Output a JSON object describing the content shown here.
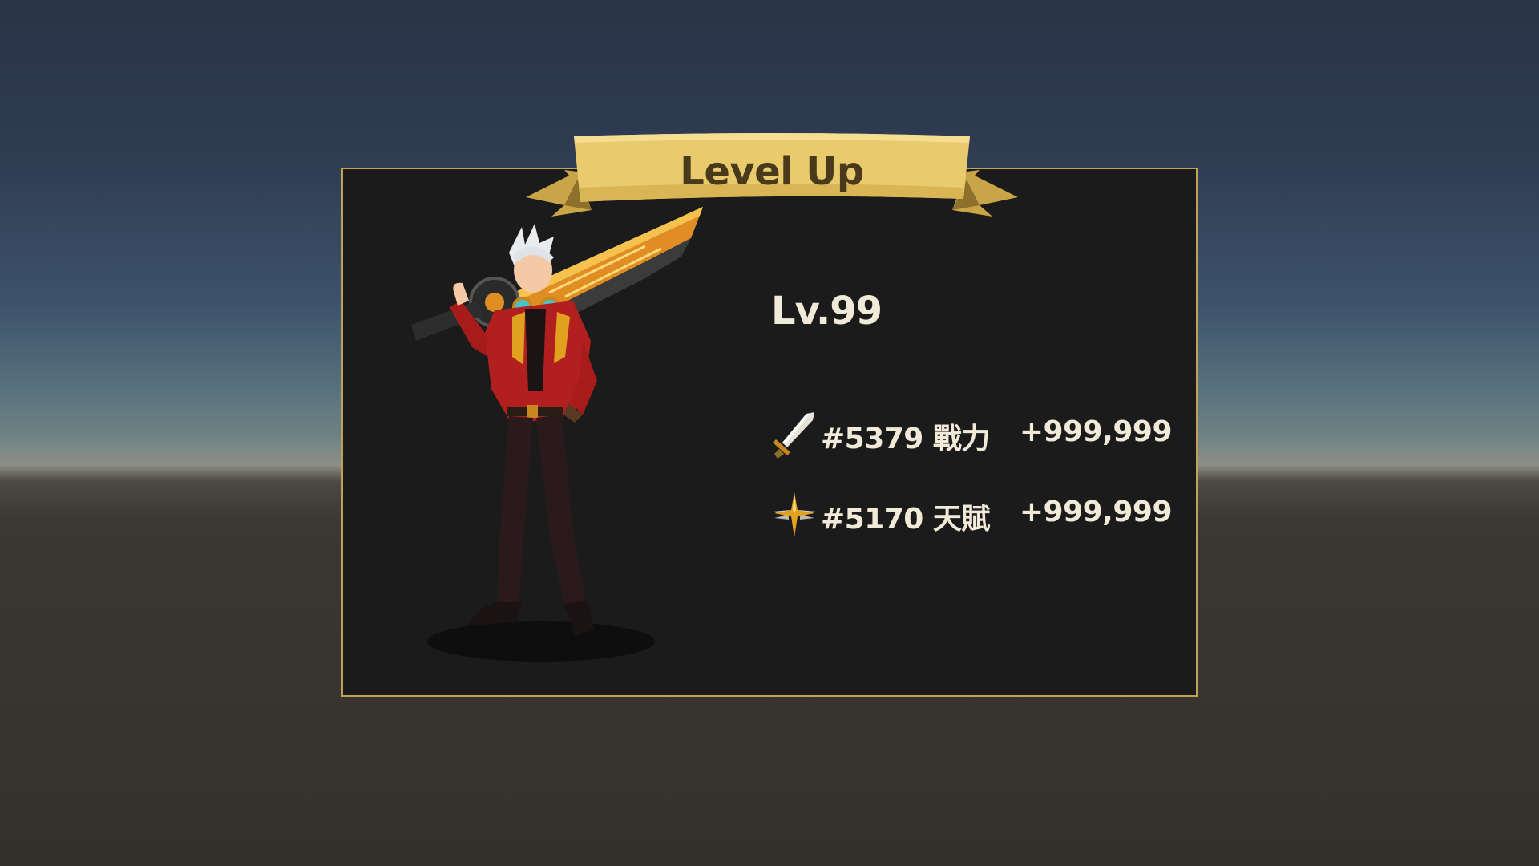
{
  "dialog": {
    "title": "Level Up",
    "level": "Lv.99",
    "stats": [
      {
        "icon": "sword-icon",
        "label": "#5379 戰力",
        "value": "+999,999"
      },
      {
        "icon": "winged-star-icon",
        "label": "#5170 天賦",
        "value": "+999,999"
      }
    ]
  },
  "colors": {
    "panel_bg": "#1b1b1b",
    "panel_border": "#bfa158",
    "banner_gold": "#e8c869",
    "text": "#f1ead8"
  }
}
